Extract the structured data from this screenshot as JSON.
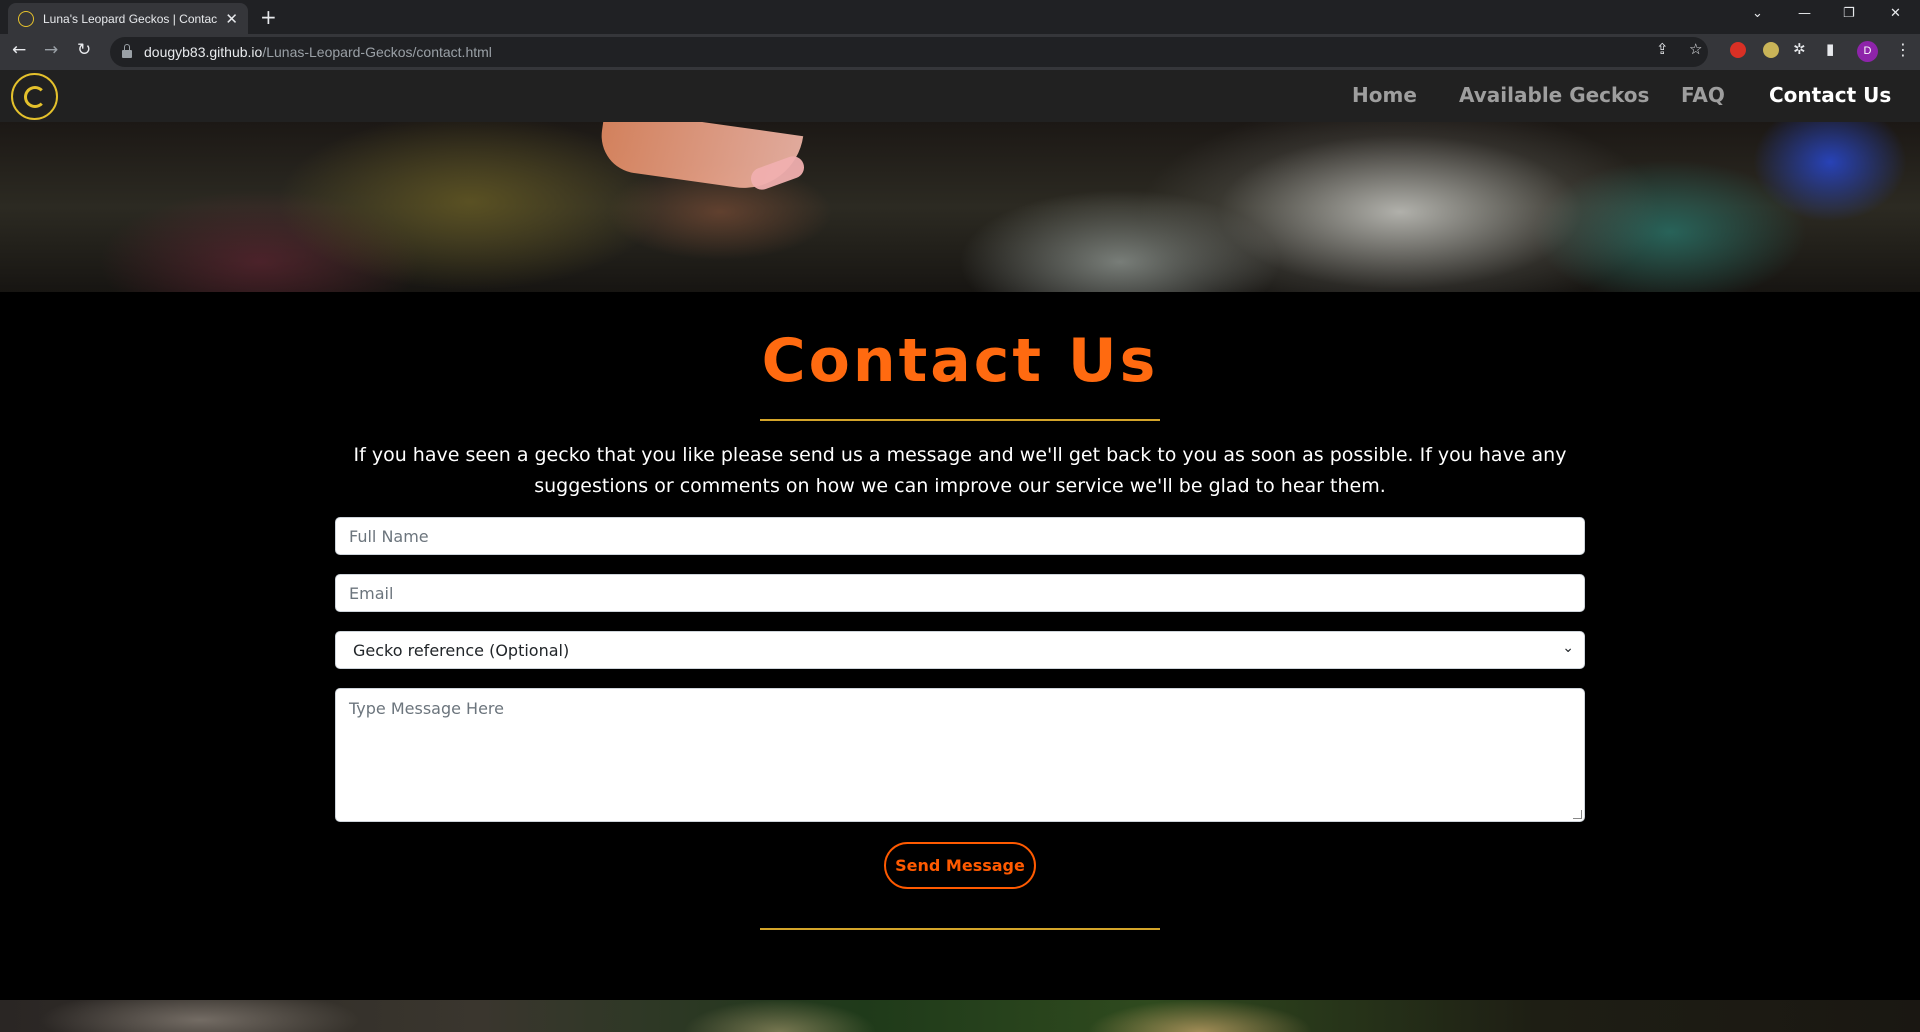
{
  "browser": {
    "tab_title": "Luna's Leopard Geckos | Contact Us",
    "tab_close": "✕",
    "new_tab": "+",
    "url_host": "dougyb83.github.io",
    "url_path": "/Lunas-Leopard-Geckos/contact.html",
    "profile_initial": "D",
    "icons": {
      "back": "←",
      "forward": "→",
      "reload": "↻",
      "share": "⇪",
      "star": "☆",
      "extensions": "✲",
      "sidepanel": "▮",
      "menu": "⋮",
      "minimize": "—",
      "restore": "❐",
      "close": "✕",
      "tab_list": "⌄"
    }
  },
  "nav": {
    "links": [
      "Home",
      "Available Geckos",
      "FAQ",
      "Contact Us"
    ],
    "active": "Contact Us"
  },
  "main": {
    "title": "Contact Us",
    "intro": "If you have seen a gecko that you like please send us a message and we'll get back to you as soon as possible. If you have any suggestions or comments on how we can improve our service we'll be glad to hear them.",
    "form": {
      "name_placeholder": "Full Name",
      "email_placeholder": "Email",
      "gecko_select_value": "Gecko reference (Optional)",
      "message_placeholder": "Type Message Here",
      "submit_label": "Send Message"
    }
  },
  "colors": {
    "accent_orange": "#ff6a10",
    "divider_gold": "#d4a52a",
    "logo_yellow": "#e4c12c",
    "nav_bg": "#212121"
  }
}
